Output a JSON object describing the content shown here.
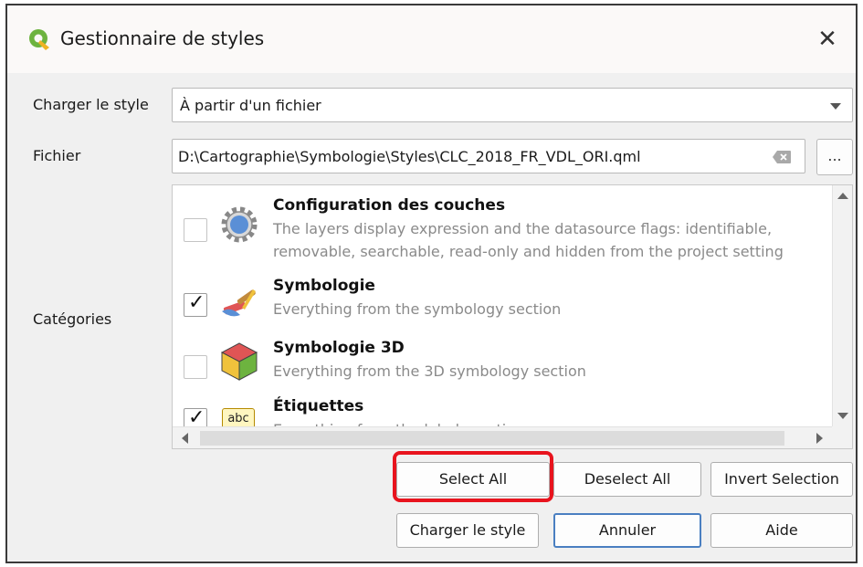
{
  "window": {
    "title": "Gestionnaire de styles",
    "close_label": "✕"
  },
  "load_style": {
    "label": "Charger le style",
    "value": "À partir d'un fichier"
  },
  "file": {
    "label": "Fichier",
    "value": "D:\\Cartographie\\Symbologie\\Styles\\CLC_2018_FR_VDL_ORI.qml",
    "browse_label": "..."
  },
  "categories": {
    "label": "Catégories",
    "items": [
      {
        "title": "Configuration des couches",
        "desc1": "The layers display expression and the datasource flags: identifiable,",
        "desc2": "removable, searchable, read-only and hidden from the project setting",
        "checked": false,
        "icon": "gear-icon"
      },
      {
        "title": "Symbologie",
        "desc1": "Everything from the symbology section",
        "checked": true,
        "icon": "paintbrush-icon"
      },
      {
        "title": "Symbologie 3D",
        "desc1": "Everything from the 3D symbology section",
        "checked": false,
        "icon": "cube-icon"
      },
      {
        "title": "Étiquettes",
        "desc1": "Everything from the labels section",
        "checked": true,
        "icon": "abc-label-icon",
        "icon_text": "abc"
      }
    ]
  },
  "buttons": {
    "select_all": "Select All",
    "deselect_all": "Deselect All",
    "invert_selection": "Invert Selection",
    "load_style": "Charger le style",
    "cancel": "Annuler",
    "help": "Aide"
  },
  "colors": {
    "highlight": "#e8141e",
    "default_button_border": "#4a7fc1",
    "qgis_green": "#6db33f"
  }
}
